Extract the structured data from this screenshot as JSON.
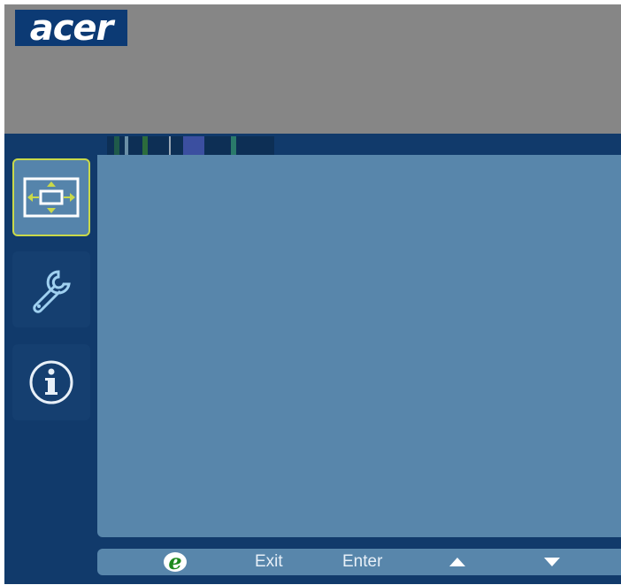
{
  "brand": {
    "logo_text": "acer"
  },
  "sidebar": {
    "items": [
      {
        "name": "picture-position",
        "icon": "screen-position-icon",
        "active": true
      },
      {
        "name": "settings",
        "icon": "wrench-icon",
        "active": false
      },
      {
        "name": "information",
        "icon": "info-icon",
        "active": false
      }
    ]
  },
  "footer": {
    "e_label": "e",
    "exit_label": "Exit",
    "enter_label": "Enter",
    "up_icon": "triangle-up-icon",
    "down_icon": "triangle-down-icon"
  },
  "colors": {
    "background": "#868686",
    "osd_dark": "#113a6b",
    "panel": "#5886ab",
    "active_border": "#c9d94a",
    "logo_bg": "#0c3a74"
  }
}
